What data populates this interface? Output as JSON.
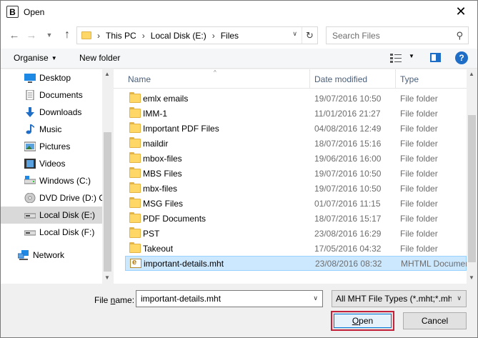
{
  "window": {
    "title": "Open",
    "app_icon_letter": "B"
  },
  "nav": {
    "breadcrumbs": [
      "This PC",
      "Local Disk (E:)",
      "Files"
    ],
    "search_placeholder": "Search Files"
  },
  "toolbar": {
    "organise": "Organise",
    "new_folder": "New folder"
  },
  "sidebar": {
    "items": [
      {
        "label": "Desktop",
        "icon": "desktop-icon"
      },
      {
        "label": "Documents",
        "icon": "documents-icon"
      },
      {
        "label": "Downloads",
        "icon": "downloads-icon"
      },
      {
        "label": "Music",
        "icon": "music-icon"
      },
      {
        "label": "Pictures",
        "icon": "pictures-icon"
      },
      {
        "label": "Videos",
        "icon": "videos-icon"
      },
      {
        "label": "Windows (C:)",
        "icon": "drive-icon"
      },
      {
        "label": "DVD Drive (D:) C",
        "icon": "dvd-icon"
      },
      {
        "label": "Local Disk (E:)",
        "icon": "drive-icon",
        "selected": true
      },
      {
        "label": "Local Disk (F:)",
        "icon": "drive-icon"
      },
      {
        "label": "Network",
        "icon": "network-icon"
      }
    ]
  },
  "columns": {
    "name": "Name",
    "date": "Date modified",
    "type": "Type"
  },
  "files": [
    {
      "name": "emlx emails",
      "date": "19/07/2016 10:50",
      "type": "File folder"
    },
    {
      "name": "IMM-1",
      "date": "11/01/2016 21:27",
      "type": "File folder"
    },
    {
      "name": "Important PDF Files",
      "date": "04/08/2016 12:49",
      "type": "File folder"
    },
    {
      "name": "maildir",
      "date": "18/07/2016 15:16",
      "type": "File folder"
    },
    {
      "name": "mbox-files",
      "date": "19/06/2016 16:00",
      "type": "File folder"
    },
    {
      "name": "MBS Files",
      "date": "19/07/2016 10:50",
      "type": "File folder"
    },
    {
      "name": "mbx-files",
      "date": "19/07/2016 10:50",
      "type": "File folder"
    },
    {
      "name": "MSG Files",
      "date": "01/07/2016 11:15",
      "type": "File folder"
    },
    {
      "name": "PDF Documents",
      "date": "18/07/2016 15:17",
      "type": "File folder"
    },
    {
      "name": "PST",
      "date": "23/08/2016 16:29",
      "type": "File folder"
    },
    {
      "name": "Takeout",
      "date": "17/05/2016 04:32",
      "type": "File folder"
    },
    {
      "name": "important-details.mht",
      "date": "23/08/2016 08:32",
      "type": "MHTML Document",
      "selected": true
    }
  ],
  "footer": {
    "filename_label_pre": "File ",
    "filename_label_u": "n",
    "filename_label_post": "ame:",
    "filename_value": "important-details.mht",
    "filetype_value": "All MHT File Types (*.mht;*.mhtml)",
    "open_label_u": "O",
    "open_label_rest": "pen",
    "cancel_label": "Cancel"
  }
}
